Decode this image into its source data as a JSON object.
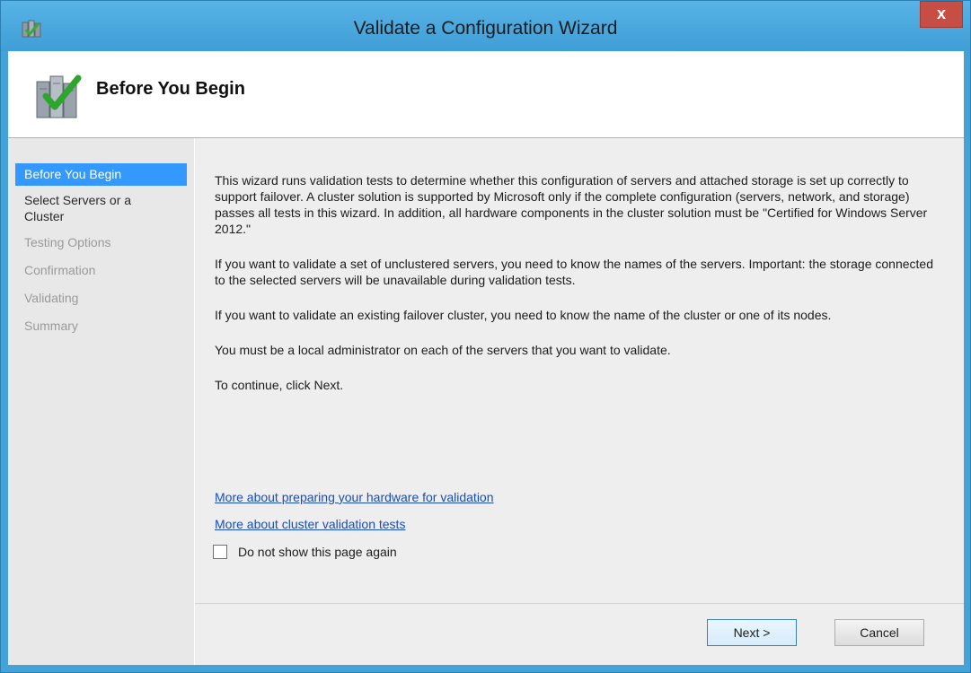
{
  "window": {
    "title": "Validate a Configuration Wizard",
    "close_label": "x",
    "accent_color": "#44a2d8"
  },
  "header": {
    "title": "Before You Begin"
  },
  "nav": {
    "items": [
      {
        "label": "Before You Begin",
        "state": "current"
      },
      {
        "label": "Select Servers or a Cluster",
        "state": "enabled"
      },
      {
        "label": "Testing Options",
        "state": "disabled"
      },
      {
        "label": "Confirmation",
        "state": "disabled"
      },
      {
        "label": "Validating",
        "state": "disabled"
      },
      {
        "label": "Summary",
        "state": "disabled"
      }
    ]
  },
  "content": {
    "paragraphs": [
      "This wizard runs validation tests to determine whether this configuration of servers and attached storage is set up correctly to support failover. A cluster solution is supported by Microsoft only if the complete configuration (servers, network, and storage) passes all tests in this wizard. In addition, all hardware components in the cluster solution must be \"Certified for Windows Server 2012.\"",
      "If you want to validate a set of unclustered servers, you need to know the names of the servers. Important: the storage connected to the selected servers will be unavailable during validation tests.",
      "If you want to validate an existing failover cluster, you need to know the name of the cluster or one of its nodes.",
      "You must be a local administrator on each of the servers that you want to validate.",
      "To continue, click Next."
    ],
    "links": [
      "More about preparing your hardware for validation",
      "More about cluster validation tests"
    ],
    "checkbox_label": "Do not show this page again",
    "checkbox_checked": false
  },
  "buttons": {
    "next": "Next >",
    "cancel": "Cancel"
  }
}
